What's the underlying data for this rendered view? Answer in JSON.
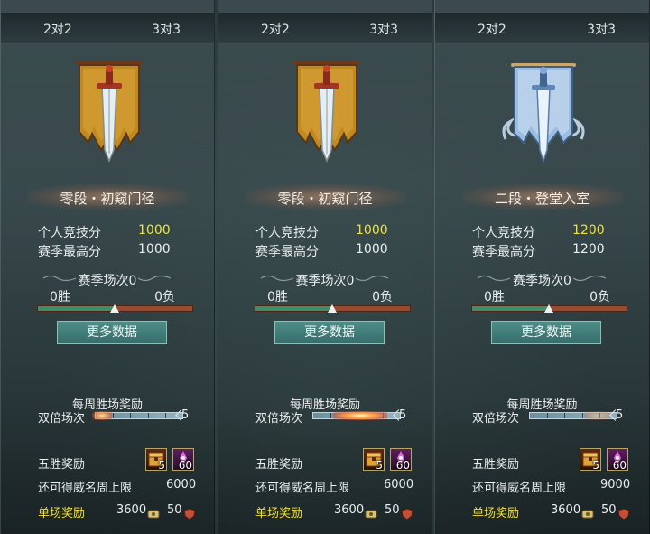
{
  "panels": [
    {
      "tabs": [
        "2对2",
        "3对3"
      ],
      "emblem": "gold-banner-sword-icon",
      "rank": "零段・初窥门径",
      "personal_label": "个人竞技分",
      "personal_value": "1000",
      "season_high_label": "赛季最高分",
      "season_high_value": "1000",
      "season_matches": "赛季场次0",
      "wins": "0胜",
      "losses": "0负",
      "win_ratio": 0.5,
      "more_button": "更多数据",
      "weekly_title": "每周胜场奖励",
      "double_label": "双倍场次",
      "double_count": "5",
      "double_flare": "light",
      "five_win_label": "五胜奖励",
      "item1_count": "5",
      "item2_count": "60",
      "cap_label": "还可得威名周上限",
      "cap_value": "6000",
      "single_label": "单场奖励",
      "single_value1": "3600",
      "single_value2": "50"
    },
    {
      "tabs": [
        "2对2",
        "3对3"
      ],
      "emblem": "gold-banner-sword-icon",
      "rank": "零段・初窥门径",
      "personal_label": "个人竞技分",
      "personal_value": "1000",
      "season_high_label": "赛季最高分",
      "season_high_value": "1000",
      "season_matches": "赛季场次0",
      "wins": "0胜",
      "losses": "0负",
      "win_ratio": 0.5,
      "more_button": "更多数据",
      "weekly_title": "每周胜场奖励",
      "double_label": "双倍场次",
      "double_count": "5",
      "double_flare": "strong",
      "five_win_label": "五胜奖励",
      "item1_count": "5",
      "item2_count": "60",
      "cap_label": "还可得威名周上限",
      "cap_value": "6000",
      "single_label": "单场奖励",
      "single_value1": "3600",
      "single_value2": "50"
    },
    {
      "tabs": [
        "2对2",
        "3对3"
      ],
      "emblem": "silver-banner-sword-icon",
      "rank": "二段・登堂入室",
      "personal_label": "个人竞技分",
      "personal_value": "1200",
      "season_high_label": "赛季最高分",
      "season_high_value": "1200",
      "season_matches": "赛季场次0",
      "wins": "0胜",
      "losses": "0负",
      "win_ratio": 0.5,
      "more_button": "更多数据",
      "weekly_title": "每周胜场奖励",
      "double_label": "双倍场次",
      "double_count": "5",
      "double_flare": "faint",
      "five_win_label": "五胜奖励",
      "item1_count": "5",
      "item2_count": "60",
      "cap_label": "还可得威名周上限",
      "cap_value": "9000",
      "single_label": "单场奖励",
      "single_value1": "3600",
      "single_value2": "50"
    }
  ],
  "colors": {
    "score_yellow": "#f0e33a",
    "button_teal": "#3d7a76",
    "win_green": "#3d8f6a",
    "loss_red": "#9a4a2f",
    "gold_banner": "#b8871e",
    "silver_banner": "#8fb4d8"
  }
}
